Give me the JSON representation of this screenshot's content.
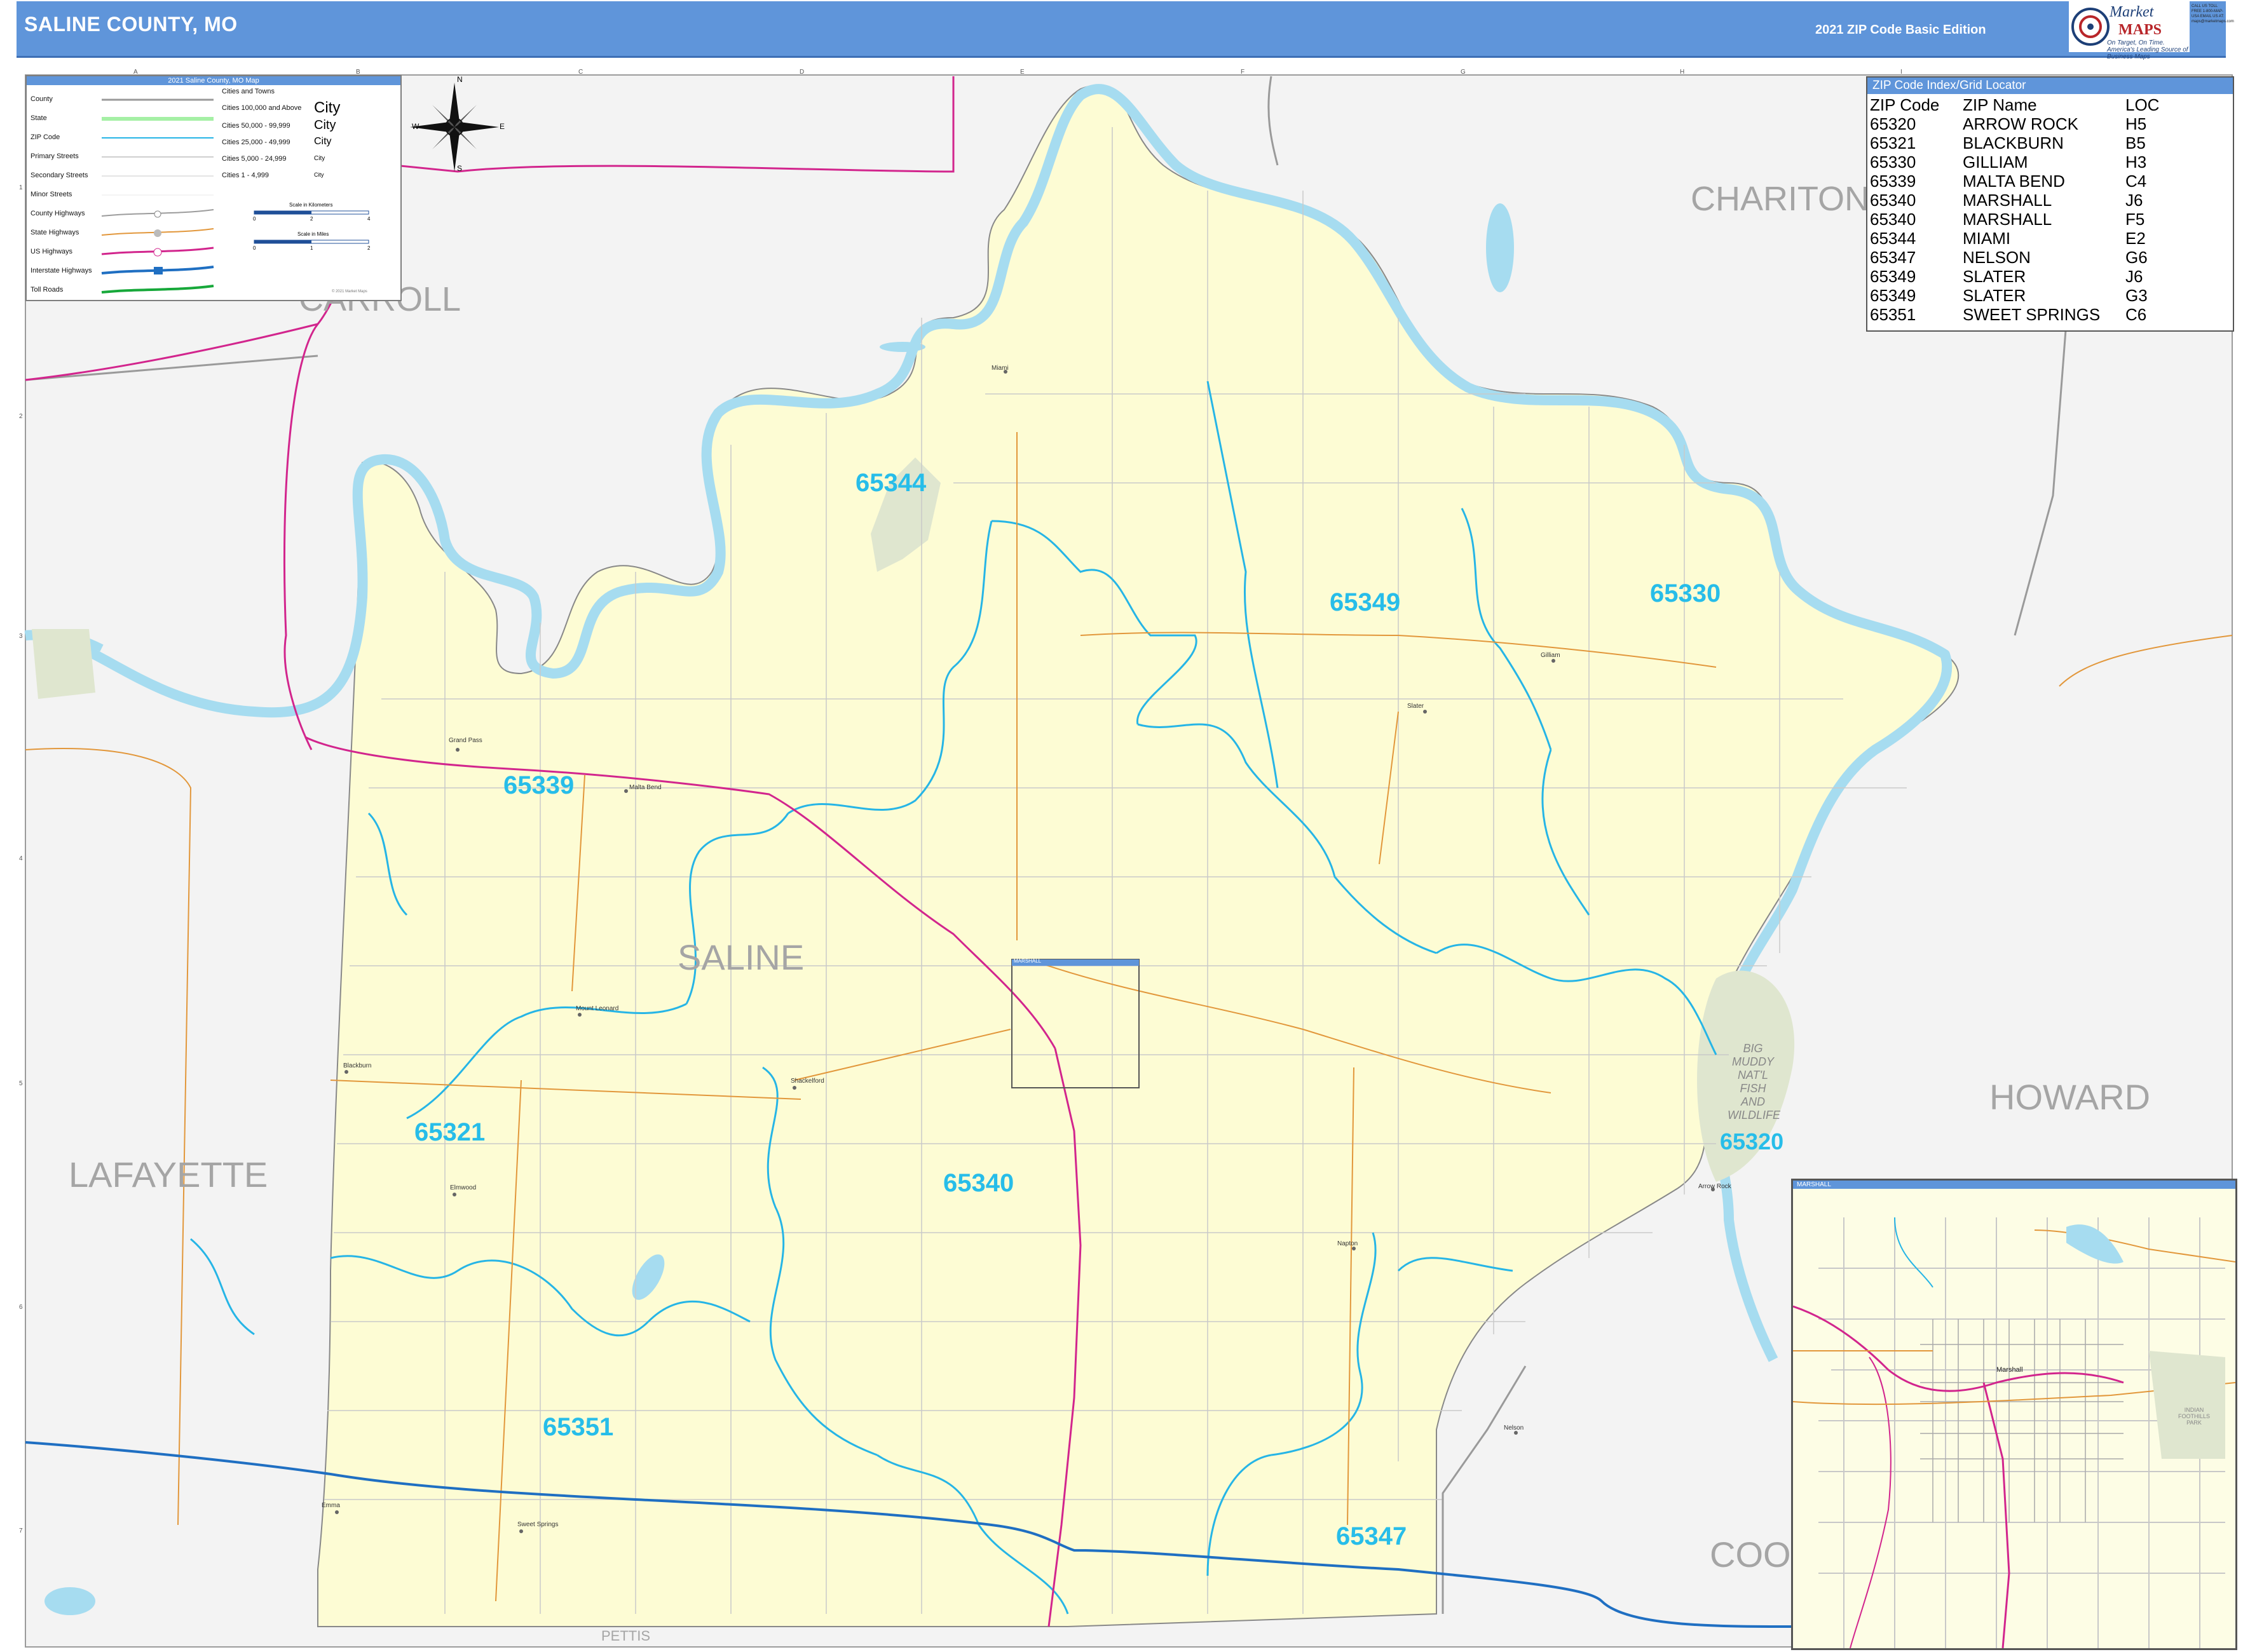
{
  "header": {
    "title": "SALINE COUNTY, MO",
    "edition": "2021 ZIP Code Basic Edition",
    "logo_text": "Market",
    "logo_maps": "MAPS",
    "logo_tagline": "On Target, On Time. America's Leading Source of Business Maps",
    "contact": "CALL US TOLL FREE 1-800-MAP-USA EMAIL US AT: maps@marketmaps.com"
  },
  "legend": {
    "title": "2021 Saline County, MO Map",
    "items": [
      "County",
      "State",
      "ZIP Code",
      "Primary Streets",
      "Secondary Streets",
      "Minor Streets",
      "County Highways",
      "State Highways",
      "US Highways",
      "Interstate Highways",
      "Toll Roads"
    ],
    "cities_title": "Cities and Towns",
    "city_classes": [
      {
        "label": "Cities 100,000 and Above",
        "sample": "City"
      },
      {
        "label": "Cities 50,000 - 99,999",
        "sample": "City"
      },
      {
        "label": "Cities 25,000 - 49,999",
        "sample": "City"
      },
      {
        "label": "Cities 5,000 - 24,999",
        "sample": "City"
      },
      {
        "label": "Cities 1 - 4,999",
        "sample": "City"
      }
    ],
    "scale_km": "Scale in Kilometers",
    "scale_mi": "Scale in Miles",
    "scale_km_ticks": [
      "0",
      "2",
      "4"
    ],
    "scale_mi_ticks": [
      "0",
      "1",
      "2"
    ],
    "copyright": "© 2021 Market Maps"
  },
  "compass": {
    "n": "N",
    "s": "S",
    "e": "E",
    "w": "W"
  },
  "zip_index": {
    "title": "ZIP Code Index/Grid Locator",
    "columns": [
      "ZIP Code",
      "ZIP Name",
      "LOC"
    ],
    "rows": [
      [
        "65320",
        "ARROW ROCK",
        "H5"
      ],
      [
        "65321",
        "BLACKBURN",
        "B5"
      ],
      [
        "65330",
        "GILLIAM",
        "H3"
      ],
      [
        "65339",
        "MALTA BEND",
        "C4"
      ],
      [
        "65340",
        "MARSHALL",
        "J6"
      ],
      [
        "65340",
        "MARSHALL",
        "F5"
      ],
      [
        "65344",
        "MIAMI",
        "E2"
      ],
      [
        "65347",
        "NELSON",
        "G6"
      ],
      [
        "65349",
        "SLATER",
        "J6"
      ],
      [
        "65349",
        "SLATER",
        "G3"
      ],
      [
        "65351",
        "SWEET SPRINGS",
        "C6"
      ]
    ]
  },
  "counties": {
    "carroll": "CARROLL",
    "chariton": "CHARITON",
    "howard": "HOWARD",
    "lafayette": "LAFAYETTE",
    "cooper": "COOPER",
    "pettis": "PETTIS",
    "saline": "SALINE"
  },
  "zip_labels": {
    "z65344": "65344",
    "z65349": "65349",
    "z65330": "65330",
    "z65339": "65339",
    "z65321": "65321",
    "z65340": "65340",
    "z65320": "65320",
    "z65351": "65351",
    "z65347": "65347"
  },
  "towns": {
    "grand_pass": "Grand Pass",
    "malta_bend": "Malta Bend",
    "mount_leonard": "Mount Leonard",
    "blackburn": "Blackburn",
    "shackelford": "Shackelford",
    "emma": "Emma",
    "sweet_springs": "Sweet Springs",
    "slater": "Slater",
    "gilliam": "Gilliam",
    "miami": "Miami",
    "arrow_rock": "Arrow Rock",
    "marshall": "Marshall",
    "nelson": "Nelson",
    "elmwood": "Elmwood",
    "napton": "Napton"
  },
  "parks": {
    "big_muddy": "BIG MUDDY NAT'L FISH AND WILDLIFE",
    "inset_park": "INDIAN FOOTHILLS PARK"
  },
  "inset": {
    "title": "MARSHALL",
    "town_label": "Marshall"
  },
  "mini_box_label": "MARSHALL",
  "grid": {
    "cols": [
      "A",
      "B",
      "C",
      "D",
      "E",
      "F",
      "G",
      "H",
      "I"
    ],
    "rows": [
      "1",
      "2",
      "3",
      "4",
      "5",
      "6",
      "7"
    ]
  },
  "colors": {
    "header": "#5f95da",
    "county_fill": "#fdfcd4",
    "water": "#a6dcf0",
    "zip_boundary": "#26b5e6",
    "us_highway": "#d2258d",
    "interstate": "#1f6fc2",
    "state_highway": "#e2973b",
    "zip_label": "#27bde9",
    "county_label": "#a5a5a5"
  }
}
